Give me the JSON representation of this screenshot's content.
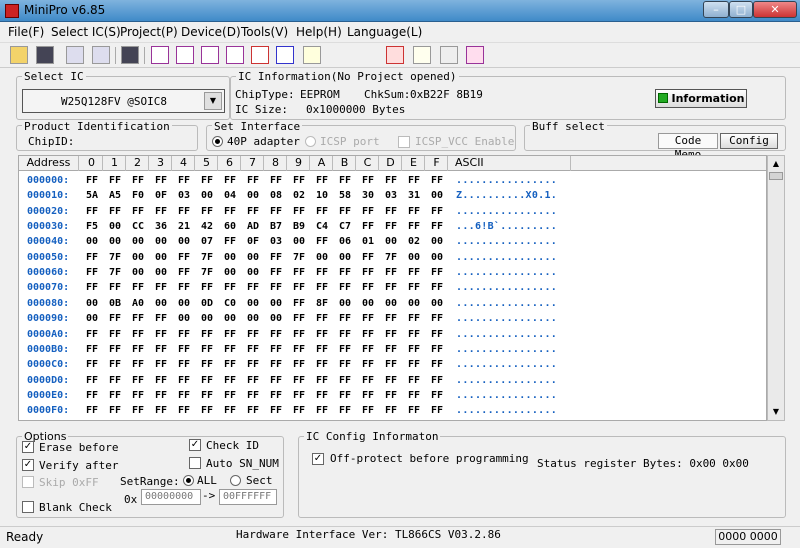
{
  "window": {
    "title": "MiniPro v6.85",
    "min": "–",
    "max": "□",
    "close": "✕"
  },
  "menu": [
    "File(F)",
    "Select IC(S)",
    "Project(P)",
    "Device(D)",
    "Tools(V)",
    "Help(H)",
    "Language(L)"
  ],
  "toolbar_icons": [
    "open-icon",
    "save-icon",
    "project-open-icon",
    "project-save-icon",
    "save-chip-icon",
    "read-icon",
    "verify-icon",
    "blank-check-icon",
    "erase-icon",
    "fill-icon",
    "read-id-icon",
    "help-icon",
    "program-icon",
    "edit-icon",
    "test-icon",
    "chip-info-icon"
  ],
  "select_ic": {
    "label": "Select IC",
    "value": "W25Q128FV @SOIC8"
  },
  "ic_info": {
    "label": "IC Information(No Project opened)",
    "chiptype_label": "ChipType:",
    "chiptype": "EEPROM",
    "chksum_label": "ChkSum:",
    "chksum": "0xB22F 8B19",
    "size_label": "IC Size:",
    "size": "0x1000000 Bytes",
    "button": "Information"
  },
  "product_id": {
    "label": "Product Identification",
    "chipid_label": "ChipID:"
  },
  "set_interface": {
    "label": "Set Interface",
    "opt1": "40P adapter",
    "opt2": "ICSP port",
    "opt3": "ICSP_VCC Enable"
  },
  "buff_select": {
    "label": "Buff select",
    "code_memo": "Code Memo",
    "config": "Config"
  },
  "grid": {
    "headers": [
      "Address",
      "0",
      "1",
      "2",
      "3",
      "4",
      "5",
      "6",
      "7",
      "8",
      "9",
      "A",
      "B",
      "C",
      "D",
      "E",
      "F",
      "ASCII"
    ],
    "rows": [
      {
        "addr": "000000:",
        "bytes": [
          "FF",
          "FF",
          "FF",
          "FF",
          "FF",
          "FF",
          "FF",
          "FF",
          "FF",
          "FF",
          "FF",
          "FF",
          "FF",
          "FF",
          "FF",
          "FF"
        ],
        "ascii": "................"
      },
      {
        "addr": "000010:",
        "bytes": [
          "5A",
          "A5",
          "F0",
          "0F",
          "03",
          "00",
          "04",
          "00",
          "08",
          "02",
          "10",
          "58",
          "30",
          "03",
          "31",
          "00"
        ],
        "ascii": "Z..........X0.1."
      },
      {
        "addr": "000020:",
        "bytes": [
          "FF",
          "FF",
          "FF",
          "FF",
          "FF",
          "FF",
          "FF",
          "FF",
          "FF",
          "FF",
          "FF",
          "FF",
          "FF",
          "FF",
          "FF",
          "FF"
        ],
        "ascii": "................"
      },
      {
        "addr": "000030:",
        "bytes": [
          "F5",
          "00",
          "CC",
          "36",
          "21",
          "42",
          "60",
          "AD",
          "B7",
          "B9",
          "C4",
          "C7",
          "FF",
          "FF",
          "FF",
          "FF"
        ],
        "ascii": "...6!B`........."
      },
      {
        "addr": "000040:",
        "bytes": [
          "00",
          "00",
          "00",
          "00",
          "00",
          "07",
          "FF",
          "0F",
          "03",
          "00",
          "FF",
          "06",
          "01",
          "00",
          "02",
          "00"
        ],
        "ascii": "................"
      },
      {
        "addr": "000050:",
        "bytes": [
          "FF",
          "7F",
          "00",
          "00",
          "FF",
          "7F",
          "00",
          "00",
          "FF",
          "7F",
          "00",
          "00",
          "FF",
          "7F",
          "00",
          "00"
        ],
        "ascii": "................"
      },
      {
        "addr": "000060:",
        "bytes": [
          "FF",
          "7F",
          "00",
          "00",
          "FF",
          "7F",
          "00",
          "00",
          "FF",
          "FF",
          "FF",
          "FF",
          "FF",
          "FF",
          "FF",
          "FF"
        ],
        "ascii": "................"
      },
      {
        "addr": "000070:",
        "bytes": [
          "FF",
          "FF",
          "FF",
          "FF",
          "FF",
          "FF",
          "FF",
          "FF",
          "FF",
          "FF",
          "FF",
          "FF",
          "FF",
          "FF",
          "FF",
          "FF"
        ],
        "ascii": "................"
      },
      {
        "addr": "000080:",
        "bytes": [
          "00",
          "0B",
          "A0",
          "00",
          "00",
          "0D",
          "C0",
          "00",
          "00",
          "FF",
          "8F",
          "00",
          "00",
          "00",
          "00",
          "00"
        ],
        "ascii": "................"
      },
      {
        "addr": "000090:",
        "bytes": [
          "00",
          "FF",
          "FF",
          "FF",
          "00",
          "00",
          "00",
          "00",
          "00",
          "FF",
          "FF",
          "FF",
          "FF",
          "FF",
          "FF",
          "FF"
        ],
        "ascii": "................"
      },
      {
        "addr": "0000A0:",
        "bytes": [
          "FF",
          "FF",
          "FF",
          "FF",
          "FF",
          "FF",
          "FF",
          "FF",
          "FF",
          "FF",
          "FF",
          "FF",
          "FF",
          "FF",
          "FF",
          "FF"
        ],
        "ascii": "................"
      },
      {
        "addr": "0000B0:",
        "bytes": [
          "FF",
          "FF",
          "FF",
          "FF",
          "FF",
          "FF",
          "FF",
          "FF",
          "FF",
          "FF",
          "FF",
          "FF",
          "FF",
          "FF",
          "FF",
          "FF"
        ],
        "ascii": "................"
      },
      {
        "addr": "0000C0:",
        "bytes": [
          "FF",
          "FF",
          "FF",
          "FF",
          "FF",
          "FF",
          "FF",
          "FF",
          "FF",
          "FF",
          "FF",
          "FF",
          "FF",
          "FF",
          "FF",
          "FF"
        ],
        "ascii": "................"
      },
      {
        "addr": "0000D0:",
        "bytes": [
          "FF",
          "FF",
          "FF",
          "FF",
          "FF",
          "FF",
          "FF",
          "FF",
          "FF",
          "FF",
          "FF",
          "FF",
          "FF",
          "FF",
          "FF",
          "FF"
        ],
        "ascii": "................"
      },
      {
        "addr": "0000E0:",
        "bytes": [
          "FF",
          "FF",
          "FF",
          "FF",
          "FF",
          "FF",
          "FF",
          "FF",
          "FF",
          "FF",
          "FF",
          "FF",
          "FF",
          "FF",
          "FF",
          "FF"
        ],
        "ascii": "................"
      },
      {
        "addr": "0000F0:",
        "bytes": [
          "FF",
          "FF",
          "FF",
          "FF",
          "FF",
          "FF",
          "FF",
          "FF",
          "FF",
          "FF",
          "FF",
          "FF",
          "FF",
          "FF",
          "FF",
          "FF"
        ],
        "ascii": "................"
      }
    ]
  },
  "options": {
    "label": "Options",
    "erase": "Erase before",
    "verify": "Verify after",
    "skip": "Skip 0xFF",
    "blank": "Blank Check",
    "check_id": "Check ID",
    "auto_sn": "Auto SN_NUM",
    "setrange": "SetRange:",
    "all": "ALL",
    "sect": "Sect",
    "hex_prefix": "0x",
    "from": "00000000",
    "arrow": "->",
    "to": "00FFFFFF"
  },
  "ic_config": {
    "label": "IC Config Informaton",
    "off_protect": "Off-protect before programming",
    "status": "Status register Bytes: 0x00 0x00"
  },
  "status": {
    "ready": "Ready",
    "hw": "Hardware Interface Ver: TL866CS V03.2.86",
    "counter": "0000 0000"
  },
  "colors": {
    "hex_blue": "#1560c0",
    "title_blue": "#3f8ac8"
  }
}
